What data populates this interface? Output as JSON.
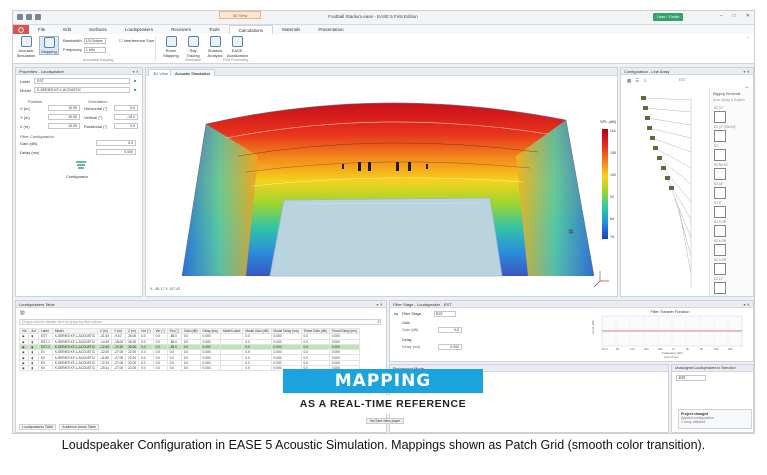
{
  "window": {
    "title": "Football Stadium.ease - EASE 5 First Edition",
    "context_tab": "3D View",
    "user_button": "User / Guide"
  },
  "ribbon_tabs": [
    "File",
    "Edit",
    "Surfaces",
    "Loudspeakers",
    "Receivers",
    "Tools",
    "Calculations",
    "Materials",
    "Presentation"
  ],
  "ribbon": {
    "acoustic_simulation": "Acoustic Simulation",
    "mapping": "Mapping",
    "bandwidth_label": "Bandwidth",
    "bandwidth_value": "1/3 Octave",
    "frequency_label": "Frequency",
    "frequency_value": "1 kHz",
    "interference_label": "Interference Sum",
    "room_mapping": "Room Mapping",
    "ray_tracing": "Ray Tracing",
    "shadow_analysis": "Shadow Analysis",
    "ease_auralization": "EASE Auralization",
    "group_acoustic": "Acoustical Mapping",
    "group_simulation": "Simulation",
    "group_post": "Post Processing"
  },
  "properties": {
    "header": "Properties - Loudspeaker",
    "label_field": "Label",
    "label_value": "EST",
    "model_field": "Model",
    "model_value": "K-SERIES KF-L-ACOUSTIC",
    "position_title": "Position",
    "orientation_title": "Orientation",
    "x_label": "X (m)",
    "x_value": "10.00",
    "y_label": "Y (m)",
    "y_value": "10.00",
    "z_label": "Z (m)",
    "z_value": "10.00",
    "h_label": "Horizontal (°)",
    "h_value": "0.0",
    "v_label": "Vertical (°)",
    "v_value": "-15.0",
    "r_label": "Rotational (°)",
    "r_value": "0.0",
    "filter_title": "Filter Configuration",
    "gain_label": "Gain (dB)",
    "gain_value": "0.0",
    "delay_label": "Delay (ms)",
    "delay_value": "0.000",
    "configurator_label": "Configurator"
  },
  "view": {
    "tab_3d": "3D View",
    "tab_acoustic": "Acoustic Simulation",
    "legend_title": "SPL (dB)",
    "legend_values": [
      "116",
      "108",
      "100",
      "92",
      "84",
      "76"
    ],
    "coords": "X:  -85.17  Y:  107.43"
  },
  "config_panel": {
    "header": "Configuration - Line Array",
    "rigging_label": "Rigging Elements",
    "auto_label": "Auto Splay & Angles",
    "slots": [
      "K2 | 0°",
      "K2 | 0° (Re K2)",
      "K2",
      "K2 Re K2",
      "K2 18°",
      "K2 5°",
      "K2 3 OR",
      "K2 4 OR",
      "K2 3 OR",
      "K2 11°"
    ]
  },
  "loudspeaker_table": {
    "header": "Loudspeakers Table",
    "search_placeholder": "Drag a column header here to group by that column",
    "columns": [
      "Vis",
      "Act",
      "Label",
      "Model",
      "X (m)",
      "Y (m)",
      "Z (m)",
      "Hor (°)",
      "Ver (°)",
      "Rot (°)",
      "Gain (dB)",
      "Delay (ms)",
      "Model Label",
      "Model Gain (dB)",
      "Model Delay (ms)",
      "Timed Gain (dB)",
      "Timed Delay (ms)"
    ],
    "rows": [
      [
        "◉",
        "▮",
        "EST",
        "K-SERIES KF-L-ACOUSTIC",
        "-21.54",
        "-9.10",
        "26.00",
        "0.0",
        "0.0",
        "-85.0",
        "0.0",
        "0.000",
        "",
        "0.0",
        "0.000",
        "0.0",
        "0.000"
      ],
      [
        "◉",
        "▮",
        "EST-1",
        "K-SERIES KF-L-ACOUSTIC",
        "-14.40",
        "-18.00",
        "26.00",
        "0.0",
        "0.0",
        "-85.0",
        "0.0",
        "0.000",
        "",
        "0.0",
        "0.000",
        "0.0",
        "0.000"
      ],
      [
        "◉",
        "▮",
        "EST-2",
        "K-SERIES KF-L-ACOUSTIC",
        "-12.40",
        "-20.30",
        "26.00",
        "0.0",
        "0.0",
        "-85.0",
        "0.0",
        "0.000",
        "",
        "0.0",
        "0.000",
        "0.0",
        "0.000"
      ],
      [
        "◉",
        "▮",
        "E1",
        "K-SERIES KF-L-ACOUSTIC",
        "-12.00",
        "-27.00",
        "22.00",
        "0.0",
        "0.0",
        "0.0",
        "0.0",
        "0.000",
        "",
        "0.0",
        "0.000",
        "0.0",
        "0.000"
      ],
      [
        "◉",
        "▮",
        "E2",
        "K-SERIES KF-L-ACOUSTIC",
        "-11.80",
        "-27.00",
        "22.00",
        "0.0",
        "0.0",
        "0.0",
        "0.0",
        "0.000",
        "",
        "0.0",
        "0.000",
        "0.0",
        "0.000"
      ],
      [
        "◉",
        "▮",
        "E3",
        "K-SERIES KF-L-ACOUSTIC",
        "-12.20",
        "-27.00",
        "22.00",
        "0.0",
        "0.0",
        "0.0",
        "0.0",
        "0.000",
        "",
        "0.0",
        "0.000",
        "0.0",
        "0.000"
      ],
      [
        "◉",
        "▮",
        "E4",
        "K-SERIES KF-L-ACOUSTIC",
        "-20.41",
        "-27.00",
        "22.00",
        "0.0",
        "0.0",
        "0.0",
        "0.0",
        "0.000",
        "",
        "0.0",
        "0.000",
        "0.0",
        "0.000"
      ]
    ],
    "highlight_row": 2,
    "bottom_tab_1": "Loudspeakers Table",
    "bottom_tab_2": "Audience Areas Table"
  },
  "filter_stage": {
    "header": "Filter Stage - Loudspeaker - EST",
    "stage": "Filter Stage",
    "stage_value": "EST",
    "gain_block": "Gain",
    "gain_label": "Gain (dB)",
    "gain_value": "0.0",
    "delay_block": "Delay",
    "delay_label": "Delay (ms)",
    "delay_value": "0.000",
    "transfer_title": "Filter Transfer Function",
    "freq_label": "Frequency (Hz)",
    "y_label": "Level (dB)",
    "legend": "Gain   Phase",
    "freq_ticks": [
      "20.0",
      "50",
      "100",
      "200",
      "500",
      "1k",
      "2k",
      "5k",
      "10k",
      "20k"
    ]
  },
  "processing": {
    "header": "Processing Mode"
  },
  "side_panel": {
    "header": "Unassigned Loudspeakers in Selection",
    "label": "EST",
    "notice_title": "Project changed",
    "notice_line1": "Applied configuration",
    "notice_line2": "1 array affected"
  },
  "overlay": {
    "title": "MAPPING",
    "subtitle": "AS A REAL-TIME REFERENCE",
    "video_label": "YouTube video player"
  },
  "caption": "Loudspeaker Configuration in EASE 5 Acoustic Simulation. Mappings shown as Patch Grid (smooth color transition).",
  "colors": {
    "accent_blue": "#1aa3dc",
    "file_tab": "#d9534f",
    "user_button": "#33a36b",
    "row_highlight": "#bfe3b5"
  }
}
